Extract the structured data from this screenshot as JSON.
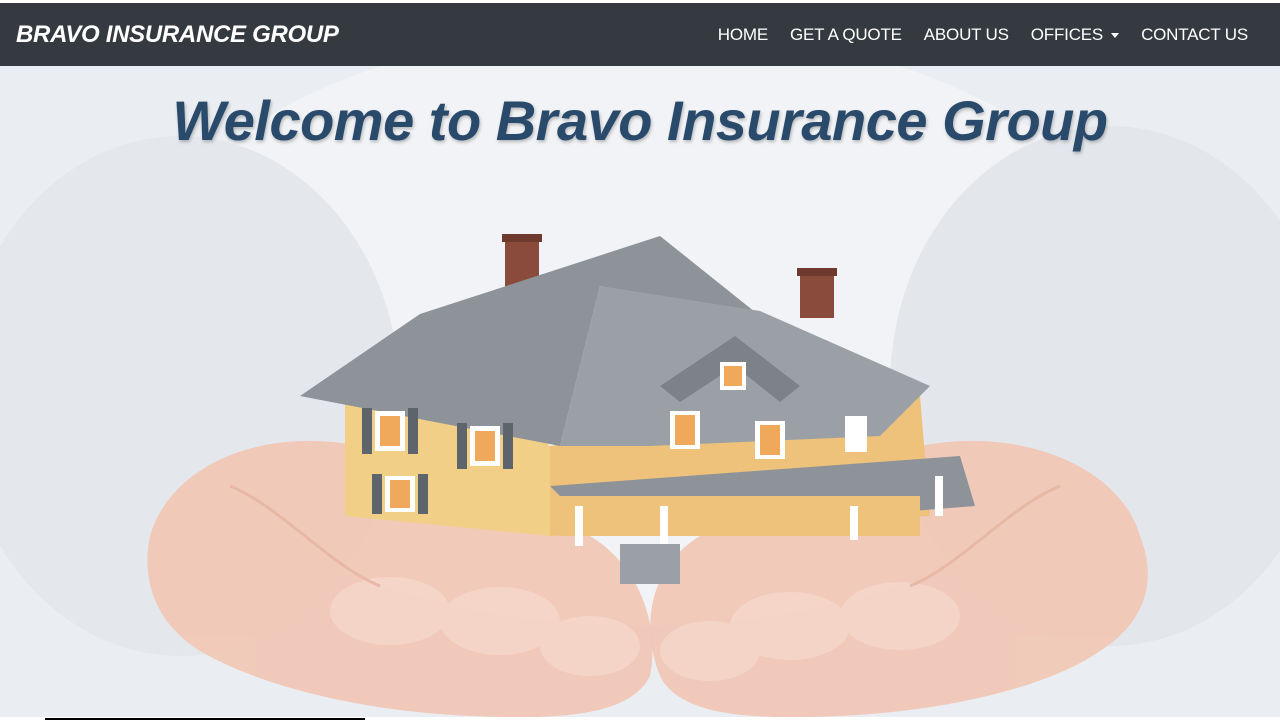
{
  "brand": {
    "name": "BRAVO INSURANCE GROUP"
  },
  "nav": {
    "items": [
      {
        "label": "HOME"
      },
      {
        "label": "GET A QUOTE"
      },
      {
        "label": "ABOUT US"
      },
      {
        "label": "OFFICES",
        "has_dropdown": true
      },
      {
        "label": "CONTACT US"
      }
    ]
  },
  "hero": {
    "title": "Welcome to Bravo Insurance Group",
    "image": "house-in-hands-illustration"
  },
  "colors": {
    "navbar_bg": "#343a40",
    "nav_text": "#ffffff",
    "title_text": "#2a4a6b"
  }
}
